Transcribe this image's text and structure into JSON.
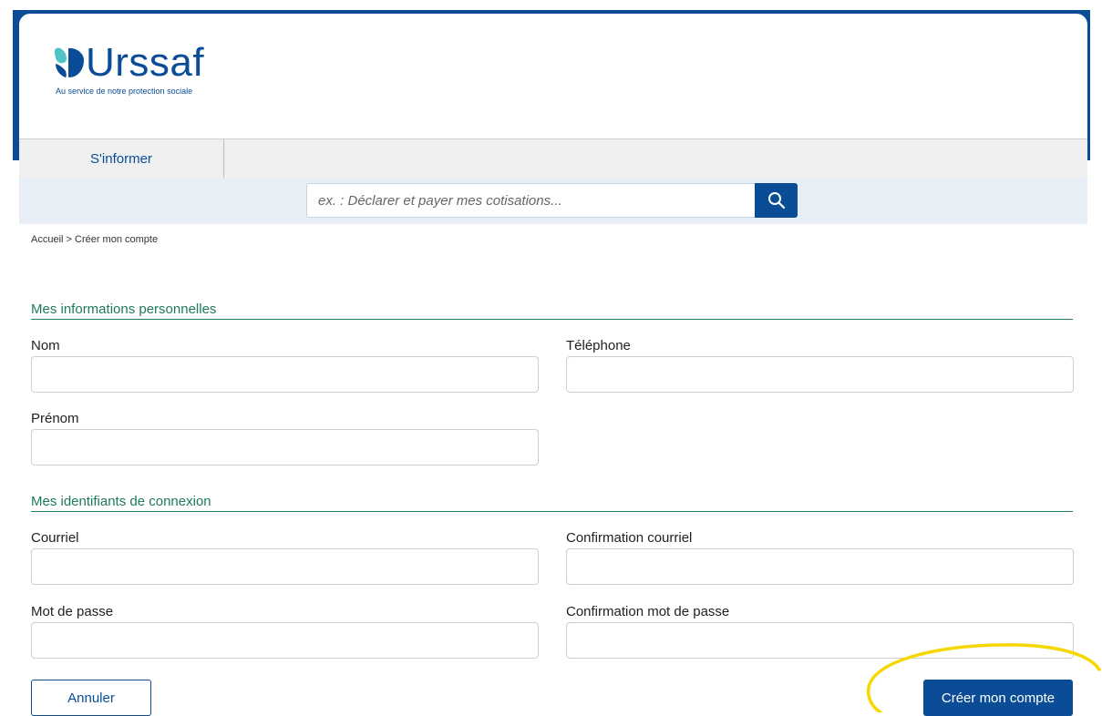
{
  "brand": {
    "name": "Urssaf",
    "tagline": "Au service de notre protection sociale",
    "primary_color": "#0a4d96",
    "accent_color": "#1e7a5c",
    "logo_icon": "urssaf-logo-mark"
  },
  "nav": {
    "items": [
      {
        "label": "S'informer"
      }
    ]
  },
  "search": {
    "placeholder": "ex. : Déclarer et payer mes cotisations...",
    "icon": "search-icon"
  },
  "breadcrumb": "Accueil > Créer mon compte",
  "sections": {
    "personal": {
      "title": "Mes informations personnelles",
      "nom": "Nom",
      "telephone": "Téléphone",
      "prenom": "Prénom"
    },
    "login": {
      "title": "Mes identifiants de connexion",
      "courriel": "Courriel",
      "confirmation_courriel": "Confirmation courriel",
      "mot_de_passe": "Mot de passe",
      "confirmation_mot_de_passe": "Confirmation mot de passe"
    }
  },
  "actions": {
    "cancel": "Annuler",
    "create": "Créer mon compte",
    "highlight_color": "#f5d800"
  }
}
